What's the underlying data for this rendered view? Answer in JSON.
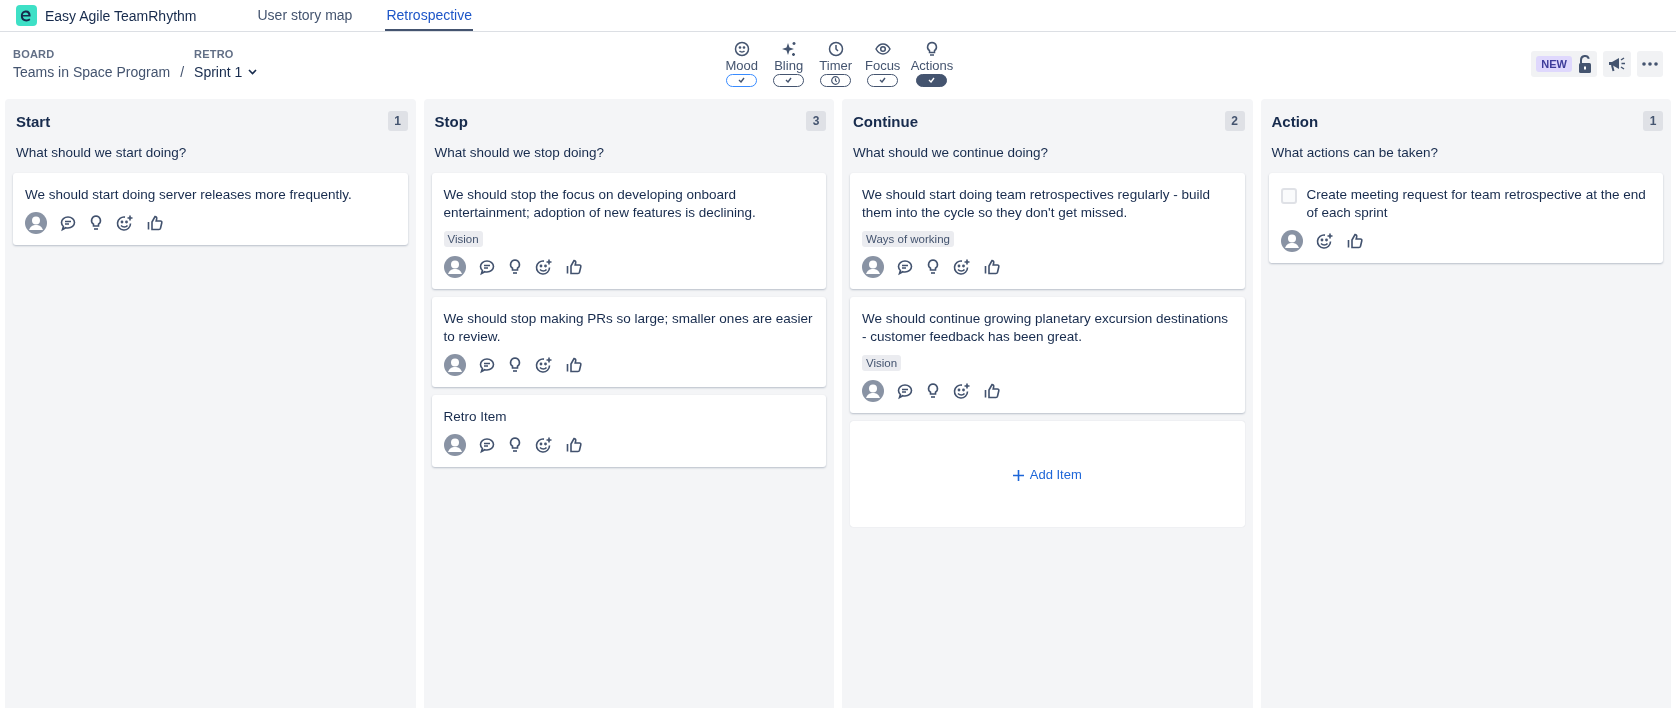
{
  "app": {
    "name": "Easy Agile TeamRhythm"
  },
  "nav_tabs": [
    {
      "label": "User story map",
      "selected": false
    },
    {
      "label": "Retrospective",
      "selected": true
    }
  ],
  "breadcrumb": {
    "board_label": "BOARD",
    "board": "Teams in Space Program",
    "separator": "/",
    "retro_label": "RETRO",
    "retro": "Sprint 1"
  },
  "features": [
    {
      "label": "Mood",
      "kind": "check",
      "on": false,
      "focused": true
    },
    {
      "label": "Bling",
      "kind": "check",
      "on": false,
      "focused": false
    },
    {
      "label": "Timer",
      "kind": "clock",
      "on": false,
      "focused": false
    },
    {
      "label": "Focus",
      "kind": "check",
      "on": false,
      "focused": false
    },
    {
      "label": "Actions",
      "kind": "check",
      "on": true,
      "focused": false
    }
  ],
  "toolbar": {
    "badge": "NEW"
  },
  "columns": [
    {
      "title": "Start",
      "count": "1",
      "prompt": "What should we start doing?",
      "cards": [
        {
          "kind": "note",
          "text": "We should start doing server releases more frequently."
        }
      ]
    },
    {
      "title": "Stop",
      "count": "3",
      "prompt": "What should we stop doing?",
      "cards": [
        {
          "kind": "note",
          "text": "We should stop the focus on developing onboard entertainment; adoption of new features is declining.",
          "tag": "Vision"
        },
        {
          "kind": "note",
          "text": "We should stop making PRs so large; smaller ones are easier to review."
        },
        {
          "kind": "note",
          "text": "Retro Item"
        }
      ]
    },
    {
      "title": "Continue",
      "count": "2",
      "prompt": "What should we continue doing?",
      "cards": [
        {
          "kind": "note",
          "text": "We should start doing team retrospectives regularly - build them into the cycle so they don't get missed.",
          "tag": "Ways of working"
        },
        {
          "kind": "note",
          "text": "We should continue growing planetary excursion destinations - customer feedback has been great.",
          "tag": "Vision"
        },
        {
          "kind": "add",
          "text": "Add Item"
        }
      ]
    },
    {
      "title": "Action",
      "count": "1",
      "prompt": "What actions can be taken?",
      "cards": [
        {
          "kind": "action",
          "text": "Create meeting request for team retrospective at the end of each sprint",
          "checked": false
        }
      ]
    }
  ]
}
